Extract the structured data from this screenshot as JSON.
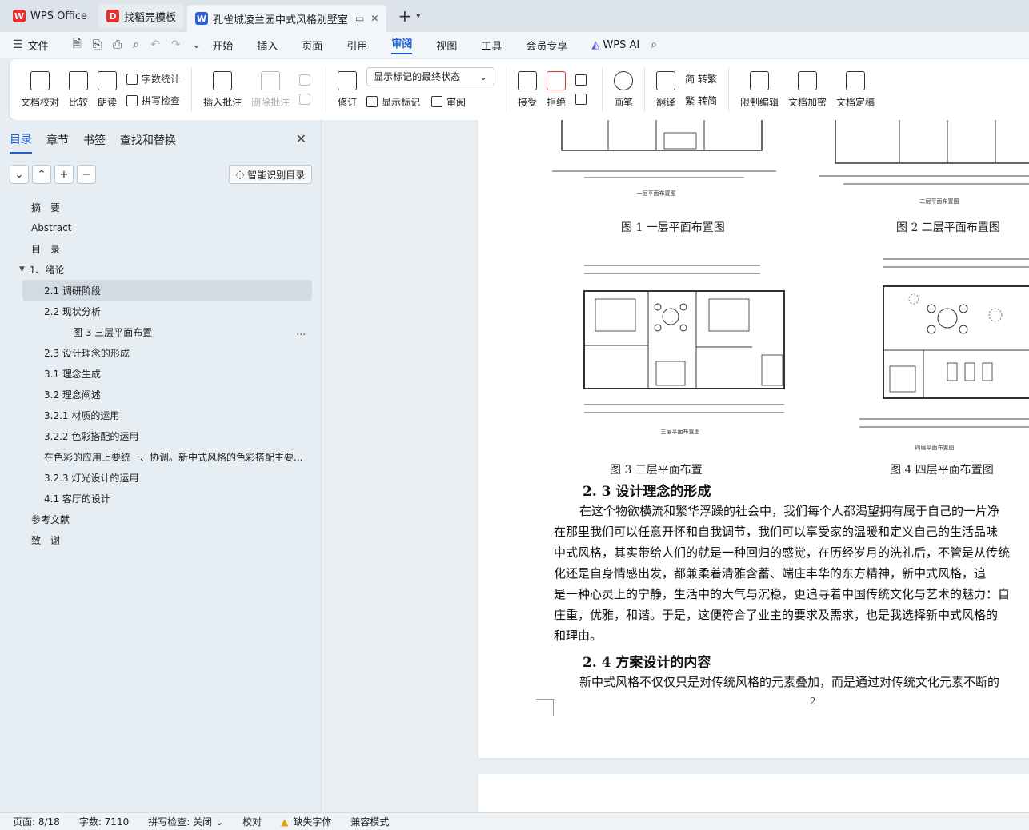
{
  "tabs": [
    {
      "label": "WPS Office",
      "logo": "W",
      "color": "#e4312b"
    },
    {
      "label": "找稻壳模板",
      "logo": "D",
      "color": "#e4312b"
    },
    {
      "label": "孔雀城凌兰园中式风格别墅室内",
      "logo": "W",
      "color": "#2b5bde"
    }
  ],
  "menu": {
    "file": "文件",
    "items": [
      "开始",
      "插入",
      "页面",
      "引用",
      "审阅",
      "视图",
      "工具",
      "会员专享"
    ],
    "active": "审阅",
    "wps_ai": "WPS AI"
  },
  "ribbon": {
    "doc_check": "文档校对",
    "compare": "比较",
    "read_aloud": "朗读",
    "word_count": "字数统计",
    "spell_check": "拼写检查",
    "insert_comment": "插入批注",
    "delete_comment": "删除批注",
    "revise": "修订",
    "markup_state": "显示标记的最终状态",
    "show_markup": "显示标记",
    "review": "审阅",
    "accept": "接受",
    "reject": "拒绝",
    "pen": "画笔",
    "translate": "翻译",
    "to_traditional": "简 转繁",
    "to_simplified": "繁 转简",
    "restrict_edit": "限制编辑",
    "doc_encrypt": "文档加密",
    "doc_finalize": "文档定稿"
  },
  "sidebar": {
    "tabs": [
      "目录",
      "章节",
      "书签",
      "查找和替换"
    ],
    "active_tab": "目录",
    "smart_toc": "智能识别目录",
    "toc": [
      {
        "label": "摘　要",
        "level": 1
      },
      {
        "label": "Abstract",
        "level": 1
      },
      {
        "label": "目　录",
        "level": 1
      },
      {
        "label": "1、绪论",
        "level": 1,
        "expanded": true
      },
      {
        "label": "2.1 调研阶段",
        "level": 2,
        "selected": true
      },
      {
        "label": "2.2 现状分析",
        "level": 2
      },
      {
        "label": "图 3 三层平面布置",
        "level": 3,
        "more": "..."
      },
      {
        "label": "2.3 设计理念的形成",
        "level": 2
      },
      {
        "label": "3.1 理念生成",
        "level": 2
      },
      {
        "label": "3.2 理念阐述",
        "level": 2
      },
      {
        "label": "3.2.1 材质的运用",
        "level": 2
      },
      {
        "label": "3.2.2 色彩搭配的运用",
        "level": 2
      },
      {
        "label": "在色彩的应用上要统一、协调。新中式风格的色彩搭配主要...",
        "level": 2
      },
      {
        "label": "3.2.3 灯光设计的运用",
        "level": 2
      },
      {
        "label": "4.1 客厅的设计",
        "level": 2
      },
      {
        "label": "参考文献",
        "level": 1
      },
      {
        "label": "致　谢",
        "level": 1
      }
    ]
  },
  "document": {
    "captions": [
      "图 1 一层平面布置图",
      "图 2 二层平面布置图",
      "图 3 三层平面布置",
      "图 4 四层平面布置图"
    ],
    "plan_labels": [
      "一层平面布置图",
      "二层平面布置图",
      "三层平面布置图",
      "四层平面布置图"
    ],
    "heading_23": "2. 3 设计理念的形成",
    "para_lines": [
      "在这个物欲横流和繁华浮躁的社会中，我们每个人都渴望拥有属于自己的一片净",
      "在那里我们可以任意开怀和自我调节，我们可以享受家的温暖和定义自己的生活品味",
      "中式风格，其实带给人们的就是一种回归的感觉，在历经岁月的洗礼后，不管是从传统",
      "化还是自身情感出发，都兼柔着清雅含蓄、端庄丰华的东方精神，新中式风格，追",
      "是一种心灵上的宁静，生活中的大气与沉稳，更追寻着中国传统文化与艺术的魅力：自",
      "庄重，优雅，和谐。于是，这便符合了业主的要求及需求，也是我选择新中式风格的",
      "和理由。"
    ],
    "heading_24": "2. 4 方案设计的内容",
    "para2": "新中式风格不仅仅只是对传统风格的元素叠加，而是通过对传统文化元素不断的",
    "page_number": "2"
  },
  "status": {
    "page": "页面: 8/18",
    "words": "字数: 7110",
    "spell": "拼写检查: 关闭",
    "proof": "校对",
    "missing_font": "缺失字体",
    "compat": "兼容模式"
  }
}
